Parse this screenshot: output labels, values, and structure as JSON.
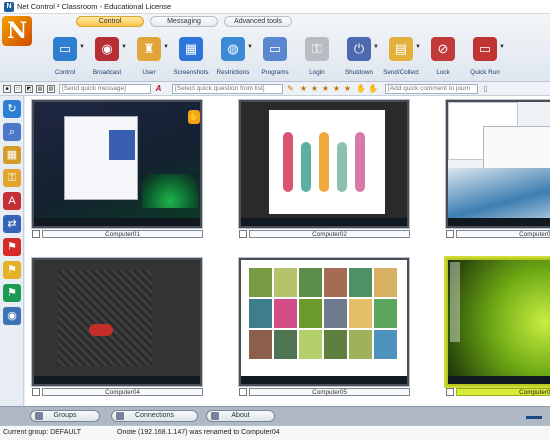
{
  "window": {
    "title": "Net Control ² Classroom - Educational License",
    "logo_letter": "N"
  },
  "ribbon": {
    "tabs": [
      {
        "label": "Control",
        "active": true
      },
      {
        "label": "Messaging",
        "active": false
      },
      {
        "label": "Advanced tools",
        "active": false
      }
    ],
    "tools": [
      {
        "label": "Control",
        "icon": "monitor-icon",
        "color": "#2f7fd0",
        "has_menu": true
      },
      {
        "label": "Broadcast",
        "icon": "broadcast-icon",
        "color": "#b52f35",
        "has_menu": true
      },
      {
        "label": "User",
        "icon": "user-icon",
        "color": "#e0a63a",
        "has_menu": true
      },
      {
        "label": "Screenshots",
        "icon": "film-icon",
        "color": "#2d75d8",
        "has_menu": false
      },
      {
        "label": "Restrictions",
        "icon": "globe-restrictions-icon",
        "color": "#3a8ad6",
        "has_menu": true
      },
      {
        "label": "Programs",
        "icon": "window-programs-icon",
        "color": "#5a87d0",
        "has_menu": false
      },
      {
        "label": "Login",
        "icon": "login-key-icon",
        "color": "#b9bcc3",
        "has_menu": false
      },
      {
        "label": "Shutdown",
        "icon": "power-icon",
        "color": "#4d6ab0",
        "has_menu": true
      },
      {
        "label": "Send/Collect",
        "icon": "documents-icon",
        "color": "#e3b03e",
        "has_menu": true
      },
      {
        "label": "Lock",
        "icon": "lock-mouse-icon",
        "color": "#c33a3a",
        "has_menu": false
      },
      {
        "label": "Quick Run",
        "icon": "quick-run-icon",
        "color": "#c03434",
        "has_menu": true
      }
    ]
  },
  "quickbar": {
    "message_placeholder": "[Send quick message]",
    "question_placeholder": "[Select quick question from list]",
    "comment_placeholder": "[Add quick comment to journ"
  },
  "sidebar": {
    "icons": [
      {
        "name": "refresh-icon",
        "color": "#2e7fd4"
      },
      {
        "name": "search-computer-icon",
        "color": "#4b77c9"
      },
      {
        "name": "arrange-view-icon",
        "color": "#d39b29"
      },
      {
        "name": "lock-icon",
        "color": "#e1a52e"
      },
      {
        "name": "text-tool-icon",
        "color": "#c52f35"
      },
      {
        "name": "shuffle-icon",
        "color": "#3464b8"
      },
      {
        "name": "red-flag-icon",
        "color": "#d52b2b"
      },
      {
        "name": "yellow-flag-icon",
        "color": "#e5b227"
      },
      {
        "name": "green-flag-icon",
        "color": "#1d9b52"
      },
      {
        "name": "user-group-icon",
        "color": "#3e71b5"
      }
    ]
  },
  "computers": [
    {
      "name": "Computer01",
      "theme": "desktop-window",
      "selected": false
    },
    {
      "name": "Computer02",
      "theme": "cactus-art",
      "selected": false
    },
    {
      "name": "Computer03",
      "theme": "file-explorer-wave",
      "selected": false
    },
    {
      "name": "Computer04",
      "theme": "sketch-board",
      "selected": false
    },
    {
      "name": "Computer05",
      "theme": "image-gallery",
      "selected": false
    },
    {
      "name": "Computer06",
      "theme": "green-wallpaper",
      "selected": true
    }
  ],
  "bottom_tabs": [
    {
      "label": "Groups"
    },
    {
      "label": "Connections"
    },
    {
      "label": "About"
    }
  ],
  "status": {
    "group": "Current group: DEFAULT",
    "message": "Onote (192.168.1.147) was renamed to Computer04"
  }
}
